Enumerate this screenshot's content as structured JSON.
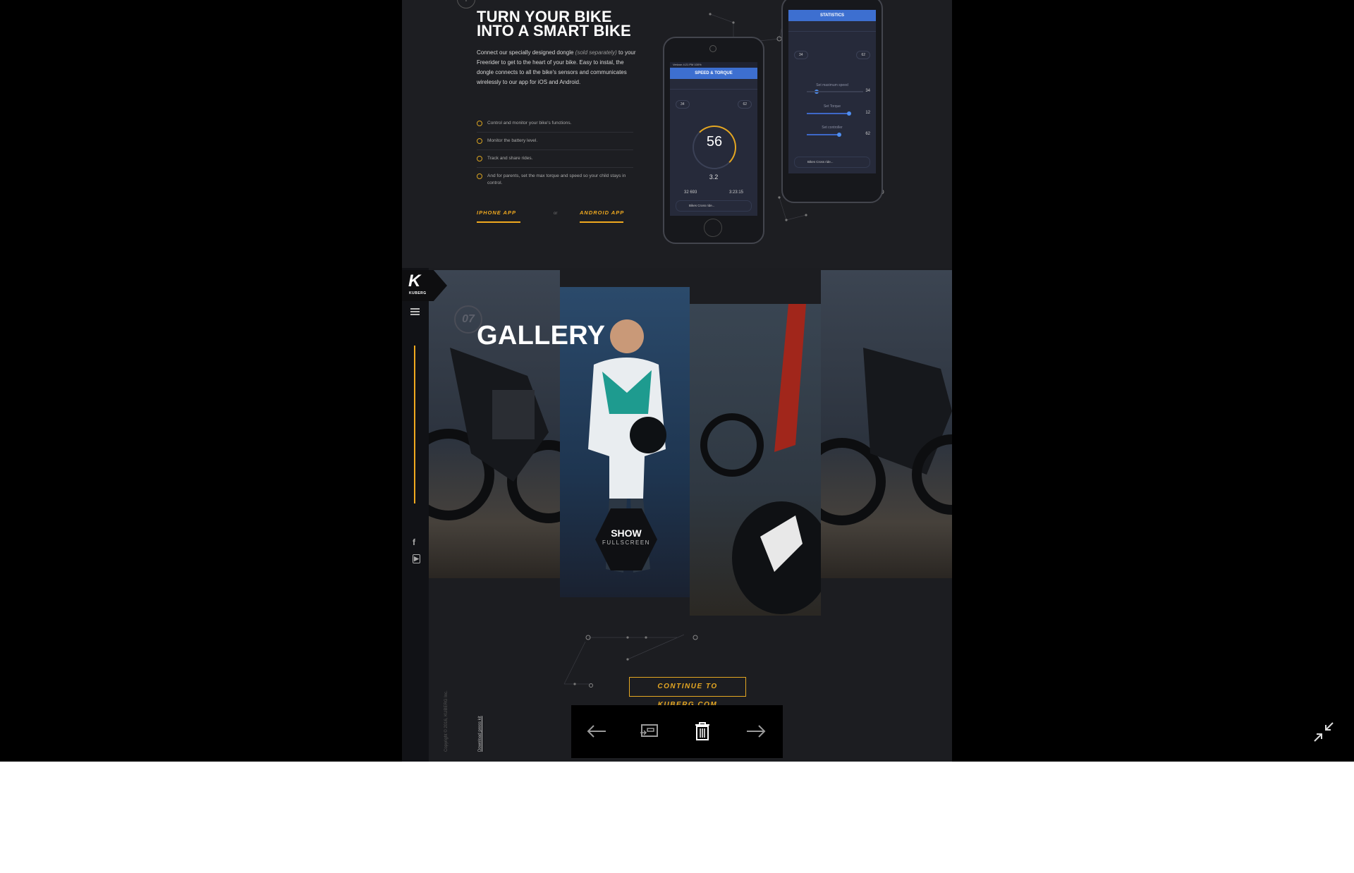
{
  "hero": {
    "title_line1": "TURN YOUR BIKE",
    "title_line2": "INTO A SMART BIKE",
    "intro_text": "Connect our specially designed dongle",
    "intro_italic": "(sold separately)",
    "intro_rest": "to your Freerider to get to the heart of your bike. Easy to instal, the dongle connects to all the bike's sensors and communicates wirelessly to our app for iOS and Android.",
    "features": [
      "Control and monitor your bike's functions.",
      "Monitor the battery level.",
      "Track and share rides.",
      "And for parents, set the max torque and speed so your child stays in control."
    ],
    "iphone_label": "IPHONE APP",
    "or_label": "or",
    "android_label": "ANDROID APP"
  },
  "phone_left": {
    "status": "Verizon  4:21 PM  100%",
    "title": "SPEED & TORQUE",
    "chip_left": "34",
    "chip_right": "62",
    "speed": "56",
    "sub_value": "3.2",
    "stat1_value": "32 693",
    "stat2_value": "3:23:15",
    "ride_label": "Bikes Cross ride..."
  },
  "phone_right": {
    "title": "STATISTICS",
    "chip_left": "34",
    "chip_right": "62",
    "slider1_label": "Set maximum speed",
    "slider1_value": "34",
    "slider2_label": "Set Torque",
    "slider2_value": "12",
    "slider3_label": "Set controller",
    "slider3_value": "62",
    "ride_label": "Bikes Cross ride..."
  },
  "gallery": {
    "section_number": "07",
    "title": "GALLERY",
    "show_line1": "SHOW",
    "show_line2": "FULLSCREEN",
    "continue_label": "CONTINUE TO KUBERG.COM"
  },
  "brand": {
    "logo_letter": "K",
    "logo_name": "KUBERG"
  },
  "footer": {
    "copyright": "Copyright © 2016, KUBERG Inc.",
    "press_kit": "Download press kit"
  },
  "viewer": {
    "prev_label": "previous",
    "next_label": "next"
  },
  "colors": {
    "accent": "#f0a91f",
    "app_blue": "#3d6fd0",
    "page_bg": "#1c1d21"
  }
}
